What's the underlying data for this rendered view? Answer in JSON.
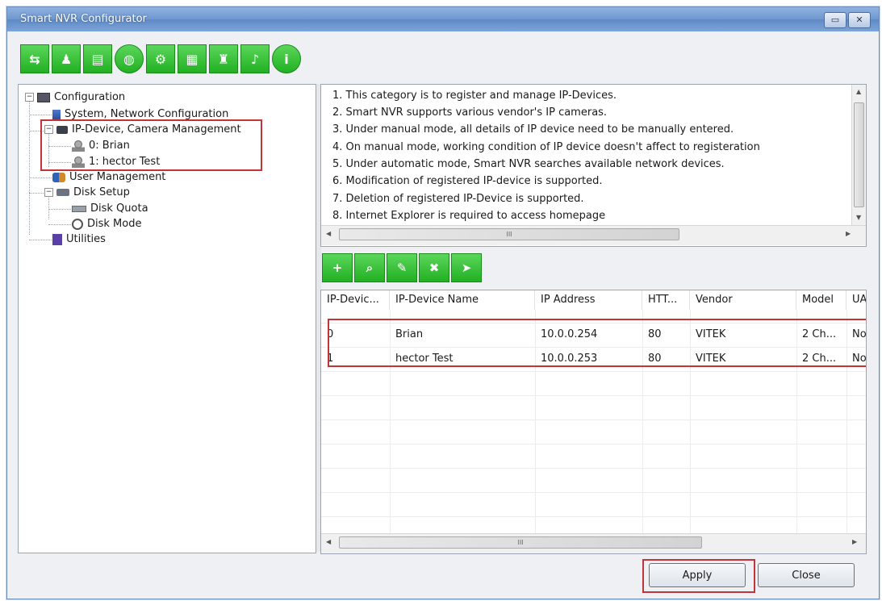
{
  "window": {
    "title": "Smart NVR Configurator",
    "min_label": "▭",
    "close_label": "✕"
  },
  "toolbar": [
    {
      "icon": "network-icon",
      "glyph": "⇆"
    },
    {
      "icon": "user-icon",
      "glyph": "♟"
    },
    {
      "icon": "disk-icon",
      "glyph": "▤"
    },
    {
      "icon": "globe-icon",
      "glyph": "◍"
    },
    {
      "icon": "device-settings-icon",
      "glyph": "⚙"
    },
    {
      "icon": "report-icon",
      "glyph": "▦"
    },
    {
      "icon": "user-settings-icon",
      "glyph": "♜"
    },
    {
      "icon": "alarm-bell-icon",
      "glyph": "♪"
    },
    {
      "icon": "info-icon",
      "glyph": "i"
    }
  ],
  "tree": {
    "root": "Configuration",
    "system": "System, Network Configuration",
    "ipdevice": "IP-Device, Camera Management",
    "dev0": "0: Brian",
    "dev1": "1: hector Test",
    "user": "User Management",
    "disk": "Disk Setup",
    "quota": "Disk Quota",
    "mode": "Disk Mode",
    "utilities": "Utilities"
  },
  "info_lines": [
    "1. This category is to register and manage IP-Devices.",
    "2. Smart NVR supports various vendor's IP cameras.",
    "3. Under manual mode, all details of IP device need to be manually entered.",
    "4. On manual mode, working condition of IP device doesn't affect to registeration",
    "5. Under automatic mode, Smart NVR searches available network devices.",
    "6. Modification of registered IP-device is supported.",
    "7. Deletion of registered IP-Device is supported.",
    "8. Internet Explorer is required to access homepage"
  ],
  "scroll": {
    "hthumb": "III"
  },
  "device_toolbar": [
    {
      "icon": "add-device-icon",
      "glyph": "+"
    },
    {
      "icon": "search-device-icon",
      "glyph": "⌕"
    },
    {
      "icon": "edit-device-icon",
      "glyph": "✎"
    },
    {
      "icon": "delete-device-icon",
      "glyph": "✖"
    },
    {
      "icon": "move-device-icon",
      "glyph": "➤"
    }
  ],
  "grid": {
    "columns": [
      "IP-Devic...",
      "IP-Device Name",
      "IP Address",
      "HTT...",
      "Vendor",
      "Model",
      "UA"
    ],
    "rows": [
      [
        "0",
        "Brian",
        "10.0.0.254",
        "80",
        "VITEK",
        "2 Ch...",
        "No"
      ],
      [
        "1",
        "hector Test",
        "10.0.0.253",
        "80",
        "VITEK",
        "2 Ch...",
        "No"
      ]
    ]
  },
  "buttons": {
    "apply": "Apply",
    "close": "Close"
  },
  "colors": {
    "highlight": "#c0343a",
    "toolbar_green": "#22b022",
    "title_blue": "#6f97cf"
  }
}
